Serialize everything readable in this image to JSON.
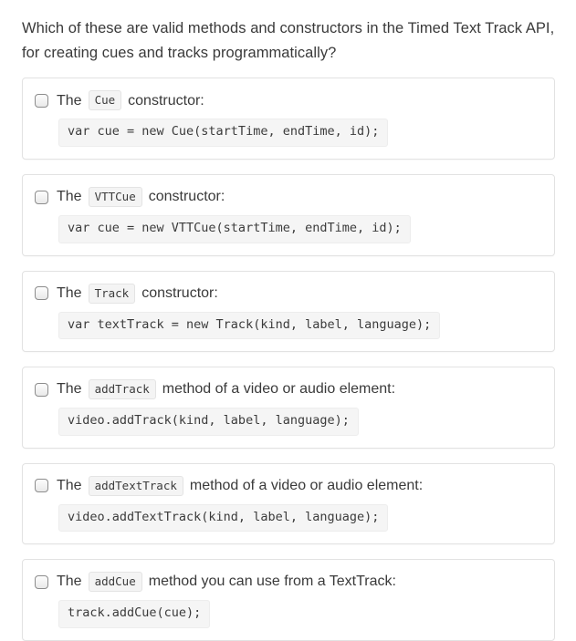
{
  "question": {
    "text": "Which of these are valid methods and constructors in the Timed Text Track API, for creating cues and tracks programmatically?"
  },
  "options": [
    {
      "prefix": "The",
      "code_chip": "Cue",
      "suffix": "constructor:",
      "code_block": "var cue = new Cue(startTime, endTime, id);",
      "checked": false
    },
    {
      "prefix": "The",
      "code_chip": "VTTCue",
      "suffix": "constructor:",
      "code_block": "var cue = new VTTCue(startTime, endTime, id);",
      "checked": false
    },
    {
      "prefix": "The",
      "code_chip": "Track",
      "suffix": "constructor:",
      "code_block": "var textTrack = new Track(kind, label, language);",
      "checked": false
    },
    {
      "prefix": "The",
      "code_chip": "addTrack",
      "suffix": "method of a video or audio element:",
      "code_block": "video.addTrack(kind, label, language);",
      "checked": false
    },
    {
      "prefix": "The",
      "code_chip": "addTextTrack",
      "suffix": "method of a video or audio element:",
      "code_block": "video.addTextTrack(kind, label, language);",
      "checked": false
    },
    {
      "prefix": "The",
      "code_chip": "addCue",
      "suffix": "method you can use from a TextTrack:",
      "code_block": "track.addCue(cue);",
      "checked": false
    }
  ]
}
